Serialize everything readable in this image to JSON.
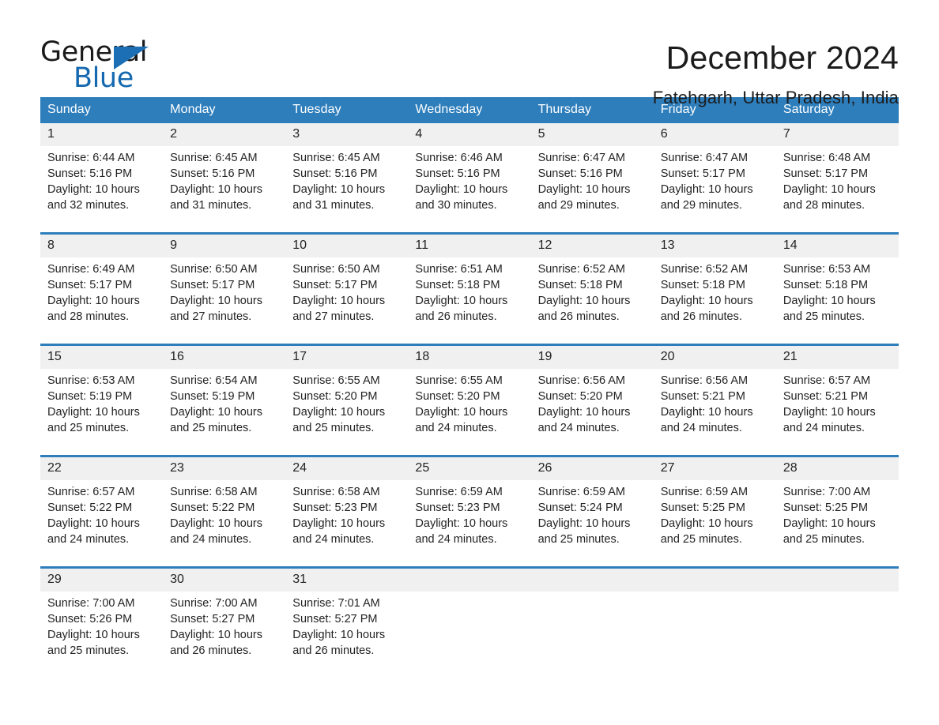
{
  "logo": {
    "word1": "General",
    "word2": "Blue",
    "triangle_color": "#1c6fb5",
    "blue_color": "#1569b0"
  },
  "header": {
    "month_title": "December 2024",
    "location": "Fatehgarh, Uttar Pradesh, India",
    "accent_color": "#2e7ebc",
    "daynum_band_color": "#f0f0f0"
  },
  "calendar": {
    "weekday_headers": [
      "Sunday",
      "Monday",
      "Tuesday",
      "Wednesday",
      "Thursday",
      "Friday",
      "Saturday"
    ],
    "weeks": [
      [
        {
          "day": "1",
          "sunrise": "Sunrise: 6:44 AM",
          "sunset": "Sunset: 5:16 PM",
          "daylight_line1": "Daylight: 10 hours",
          "daylight_line2": "and 32 minutes."
        },
        {
          "day": "2",
          "sunrise": "Sunrise: 6:45 AM",
          "sunset": "Sunset: 5:16 PM",
          "daylight_line1": "Daylight: 10 hours",
          "daylight_line2": "and 31 minutes."
        },
        {
          "day": "3",
          "sunrise": "Sunrise: 6:45 AM",
          "sunset": "Sunset: 5:16 PM",
          "daylight_line1": "Daylight: 10 hours",
          "daylight_line2": "and 31 minutes."
        },
        {
          "day": "4",
          "sunrise": "Sunrise: 6:46 AM",
          "sunset": "Sunset: 5:16 PM",
          "daylight_line1": "Daylight: 10 hours",
          "daylight_line2": "and 30 minutes."
        },
        {
          "day": "5",
          "sunrise": "Sunrise: 6:47 AM",
          "sunset": "Sunset: 5:16 PM",
          "daylight_line1": "Daylight: 10 hours",
          "daylight_line2": "and 29 minutes."
        },
        {
          "day": "6",
          "sunrise": "Sunrise: 6:47 AM",
          "sunset": "Sunset: 5:17 PM",
          "daylight_line1": "Daylight: 10 hours",
          "daylight_line2": "and 29 minutes."
        },
        {
          "day": "7",
          "sunrise": "Sunrise: 6:48 AM",
          "sunset": "Sunset: 5:17 PM",
          "daylight_line1": "Daylight: 10 hours",
          "daylight_line2": "and 28 minutes."
        }
      ],
      [
        {
          "day": "8",
          "sunrise": "Sunrise: 6:49 AM",
          "sunset": "Sunset: 5:17 PM",
          "daylight_line1": "Daylight: 10 hours",
          "daylight_line2": "and 28 minutes."
        },
        {
          "day": "9",
          "sunrise": "Sunrise: 6:50 AM",
          "sunset": "Sunset: 5:17 PM",
          "daylight_line1": "Daylight: 10 hours",
          "daylight_line2": "and 27 minutes."
        },
        {
          "day": "10",
          "sunrise": "Sunrise: 6:50 AM",
          "sunset": "Sunset: 5:17 PM",
          "daylight_line1": "Daylight: 10 hours",
          "daylight_line2": "and 27 minutes."
        },
        {
          "day": "11",
          "sunrise": "Sunrise: 6:51 AM",
          "sunset": "Sunset: 5:18 PM",
          "daylight_line1": "Daylight: 10 hours",
          "daylight_line2": "and 26 minutes."
        },
        {
          "day": "12",
          "sunrise": "Sunrise: 6:52 AM",
          "sunset": "Sunset: 5:18 PM",
          "daylight_line1": "Daylight: 10 hours",
          "daylight_line2": "and 26 minutes."
        },
        {
          "day": "13",
          "sunrise": "Sunrise: 6:52 AM",
          "sunset": "Sunset: 5:18 PM",
          "daylight_line1": "Daylight: 10 hours",
          "daylight_line2": "and 26 minutes."
        },
        {
          "day": "14",
          "sunrise": "Sunrise: 6:53 AM",
          "sunset": "Sunset: 5:18 PM",
          "daylight_line1": "Daylight: 10 hours",
          "daylight_line2": "and 25 minutes."
        }
      ],
      [
        {
          "day": "15",
          "sunrise": "Sunrise: 6:53 AM",
          "sunset": "Sunset: 5:19 PM",
          "daylight_line1": "Daylight: 10 hours",
          "daylight_line2": "and 25 minutes."
        },
        {
          "day": "16",
          "sunrise": "Sunrise: 6:54 AM",
          "sunset": "Sunset: 5:19 PM",
          "daylight_line1": "Daylight: 10 hours",
          "daylight_line2": "and 25 minutes."
        },
        {
          "day": "17",
          "sunrise": "Sunrise: 6:55 AM",
          "sunset": "Sunset: 5:20 PM",
          "daylight_line1": "Daylight: 10 hours",
          "daylight_line2": "and 25 minutes."
        },
        {
          "day": "18",
          "sunrise": "Sunrise: 6:55 AM",
          "sunset": "Sunset: 5:20 PM",
          "daylight_line1": "Daylight: 10 hours",
          "daylight_line2": "and 24 minutes."
        },
        {
          "day": "19",
          "sunrise": "Sunrise: 6:56 AM",
          "sunset": "Sunset: 5:20 PM",
          "daylight_line1": "Daylight: 10 hours",
          "daylight_line2": "and 24 minutes."
        },
        {
          "day": "20",
          "sunrise": "Sunrise: 6:56 AM",
          "sunset": "Sunset: 5:21 PM",
          "daylight_line1": "Daylight: 10 hours",
          "daylight_line2": "and 24 minutes."
        },
        {
          "day": "21",
          "sunrise": "Sunrise: 6:57 AM",
          "sunset": "Sunset: 5:21 PM",
          "daylight_line1": "Daylight: 10 hours",
          "daylight_line2": "and 24 minutes."
        }
      ],
      [
        {
          "day": "22",
          "sunrise": "Sunrise: 6:57 AM",
          "sunset": "Sunset: 5:22 PM",
          "daylight_line1": "Daylight: 10 hours",
          "daylight_line2": "and 24 minutes."
        },
        {
          "day": "23",
          "sunrise": "Sunrise: 6:58 AM",
          "sunset": "Sunset: 5:22 PM",
          "daylight_line1": "Daylight: 10 hours",
          "daylight_line2": "and 24 minutes."
        },
        {
          "day": "24",
          "sunrise": "Sunrise: 6:58 AM",
          "sunset": "Sunset: 5:23 PM",
          "daylight_line1": "Daylight: 10 hours",
          "daylight_line2": "and 24 minutes."
        },
        {
          "day": "25",
          "sunrise": "Sunrise: 6:59 AM",
          "sunset": "Sunset: 5:23 PM",
          "daylight_line1": "Daylight: 10 hours",
          "daylight_line2": "and 24 minutes."
        },
        {
          "day": "26",
          "sunrise": "Sunrise: 6:59 AM",
          "sunset": "Sunset: 5:24 PM",
          "daylight_line1": "Daylight: 10 hours",
          "daylight_line2": "and 25 minutes."
        },
        {
          "day": "27",
          "sunrise": "Sunrise: 6:59 AM",
          "sunset": "Sunset: 5:25 PM",
          "daylight_line1": "Daylight: 10 hours",
          "daylight_line2": "and 25 minutes."
        },
        {
          "day": "28",
          "sunrise": "Sunrise: 7:00 AM",
          "sunset": "Sunset: 5:25 PM",
          "daylight_line1": "Daylight: 10 hours",
          "daylight_line2": "and 25 minutes."
        }
      ],
      [
        {
          "day": "29",
          "sunrise": "Sunrise: 7:00 AM",
          "sunset": "Sunset: 5:26 PM",
          "daylight_line1": "Daylight: 10 hours",
          "daylight_line2": "and 25 minutes."
        },
        {
          "day": "30",
          "sunrise": "Sunrise: 7:00 AM",
          "sunset": "Sunset: 5:27 PM",
          "daylight_line1": "Daylight: 10 hours",
          "daylight_line2": "and 26 minutes."
        },
        {
          "day": "31",
          "sunrise": "Sunrise: 7:01 AM",
          "sunset": "Sunset: 5:27 PM",
          "daylight_line1": "Daylight: 10 hours",
          "daylight_line2": "and 26 minutes."
        },
        {
          "day": "",
          "sunrise": "",
          "sunset": "",
          "daylight_line1": "",
          "daylight_line2": ""
        },
        {
          "day": "",
          "sunrise": "",
          "sunset": "",
          "daylight_line1": "",
          "daylight_line2": ""
        },
        {
          "day": "",
          "sunrise": "",
          "sunset": "",
          "daylight_line1": "",
          "daylight_line2": ""
        },
        {
          "day": "",
          "sunrise": "",
          "sunset": "",
          "daylight_line1": "",
          "daylight_line2": ""
        }
      ]
    ]
  }
}
